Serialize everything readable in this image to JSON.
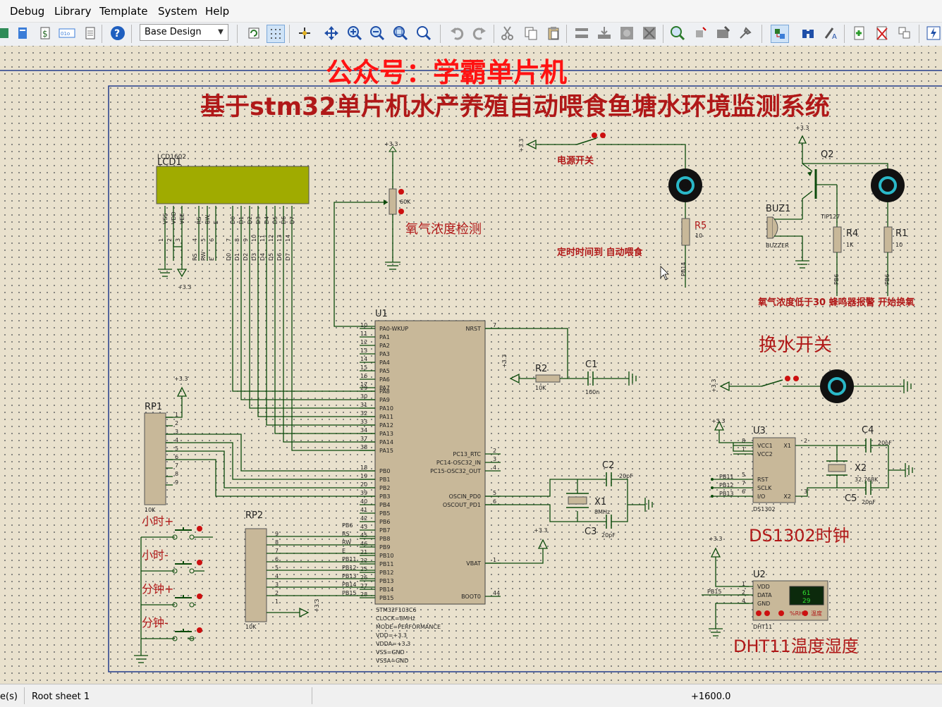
{
  "menu": {
    "debug": "Debug",
    "library": "Library",
    "template": "Template",
    "system": "System",
    "help": "Help"
  },
  "toolbar": {
    "layer_select": "Base Design"
  },
  "schematic": {
    "watermark": "公众号：学霸单片机",
    "title": "基于stm32单片机水产养殖自动喂食鱼塘水环境监测系统",
    "lcd": {
      "ref": "LCD1",
      "part": "LCD1602",
      "pins_top": [
        "VSS",
        "VDD",
        "VEE",
        "RS",
        "RW",
        "E",
        "D0",
        "D1",
        "D2",
        "D3",
        "D4",
        "D5",
        "D6",
        "D7"
      ],
      "pin_nums": [
        "1",
        "2",
        "3",
        "4",
        "5",
        "6",
        "7",
        "8",
        "9",
        "10",
        "11",
        "12",
        "13",
        "14"
      ],
      "net_labels": [
        "RS",
        "RW",
        "E",
        "D0",
        "D1",
        "D2",
        "D3",
        "D4",
        "D5",
        "D6",
        "D7"
      ]
    },
    "power": {
      "v33": "+3.3"
    },
    "pot": {
      "value": "60K",
      "label": "氧气浓度检测"
    },
    "power_switch": "电源开关",
    "feed_label": "定时时间到 自动喂食",
    "r5": {
      "ref": "R5",
      "value": "10"
    },
    "pb14": "PB14",
    "q2": {
      "ref": "Q2",
      "part": "TIP127"
    },
    "buz": {
      "ref": "BUZ1",
      "part": "BUZZER"
    },
    "r4": {
      "ref": "R4",
      "value": "1K"
    },
    "r1": {
      "ref": "R1",
      "value": "10"
    },
    "pb6": "PB6",
    "alarm": "氧气浓度低于30  蜂鸣器报警 开始换氧",
    "water_switch": "换水开关",
    "mcu": {
      "ref": "U1",
      "part": "STM32F103C6",
      "props": [
        "CLOCK=8MHz",
        "MODE=PERFORMANCE",
        "VDD=+3.3",
        "VDDA=+3.3",
        "VSS=GND",
        "VSSA=GND"
      ],
      "pa_pins": [
        "PA0-WKUP",
        "PA1",
        "PA2",
        "PA3",
        "PA4",
        "PA5",
        "PA6",
        "PA7",
        "PA8",
        "PA9",
        "PA10",
        "PA11",
        "PA12",
        "PA13",
        "PA14",
        "PA15"
      ],
      "pa_nums": [
        "10",
        "11",
        "12",
        "13",
        "14",
        "15",
        "16",
        "17",
        "29",
        "30",
        "31",
        "32",
        "33",
        "34",
        "37",
        "38"
      ],
      "pb_pins": [
        "PB0",
        "PB1",
        "PB2",
        "PB3",
        "PB4",
        "PB5",
        "PB6",
        "PB7",
        "PB8",
        "PB9",
        "PB10",
        "PB11",
        "PB12",
        "PB13",
        "PB14",
        "PB15"
      ],
      "pb_nums": [
        "18",
        "19",
        "20",
        "39",
        "40",
        "41",
        "42",
        "43",
        "45",
        "46",
        "21",
        "22",
        "25",
        "26",
        "27",
        "28"
      ],
      "right_pins": [
        "NRST",
        "PC13_RTC",
        "PC14-OSC32_IN",
        "PC15-OSC32_OUT",
        "OSCIN_PD0",
        "OSCOUT_PD1",
        "VBAT",
        "BOOT0"
      ],
      "right_nums": [
        "7",
        "2",
        "3",
        "4",
        "5",
        "6",
        "1",
        "44"
      ]
    },
    "rp2_nets": [
      "PB6",
      "RS",
      "RW",
      "E",
      "PB11",
      "PB12",
      "PB13",
      "PB14",
      "PB15"
    ],
    "r2": {
      "ref": "R2",
      "value": "10K"
    },
    "c1": {
      "ref": "C1",
      "value": "100n"
    },
    "c2": {
      "ref": "C2",
      "value": "20pF"
    },
    "c3": {
      "ref": "C3",
      "value": "20pF"
    },
    "x1": {
      "ref": "X1",
      "value": "8MHz"
    },
    "rp1": {
      "ref": "RP1",
      "value": "10K",
      "pins": [
        "1",
        "2",
        "3",
        "4",
        "5",
        "6",
        "7",
        "8",
        "9"
      ]
    },
    "rp2": {
      "ref": "RP2",
      "value": "10K",
      "pins": [
        "9",
        "8",
        "7",
        "6",
        "5",
        "4",
        "3",
        "2",
        "1"
      ]
    },
    "buttons": [
      "小时+",
      "小时-",
      "分钟+",
      "分钟-"
    ],
    "u3": {
      "ref": "U3",
      "part": "DS1302",
      "pins_left": [
        "VCC1",
        "VCC2",
        "RST",
        "SCLK",
        "I/O"
      ],
      "pins_right": [
        "X1",
        "X2"
      ],
      "nets": [
        "PB11",
        "PB12",
        "PB13"
      ],
      "nums": [
        "8",
        "1",
        "5",
        "7",
        "6",
        "2",
        "3"
      ]
    },
    "c4": {
      "ref": "C4",
      "value": "20pF"
    },
    "c5": {
      "ref": "C5",
      "value": "20pF"
    },
    "x2": {
      "ref": "X2",
      "value": "32.768K"
    },
    "ds1302_label": "DS1302时钟",
    "u2": {
      "ref": "U2",
      "part": "DHT11",
      "pins": [
        "VDD",
        "DATA",
        "GND"
      ],
      "nums": [
        "1",
        "2",
        "4"
      ],
      "net": "PB15",
      "disp_top": "61",
      "disp_bot": "29",
      "rh": "%RH",
      "temp": "温度"
    },
    "dht_label": "DHT11温度湿度"
  },
  "status": {
    "left": "e(s)",
    "sheet": "Root sheet 1",
    "coord": "+1600.0"
  },
  "colors": {
    "canvas": "#e9e1cd",
    "wire": "#0b4a0b",
    "border": "#223c8c",
    "title": "#b01818",
    "red": "#ff1212",
    "part": "#c8b899",
    "lcd": "#a0ab00"
  }
}
